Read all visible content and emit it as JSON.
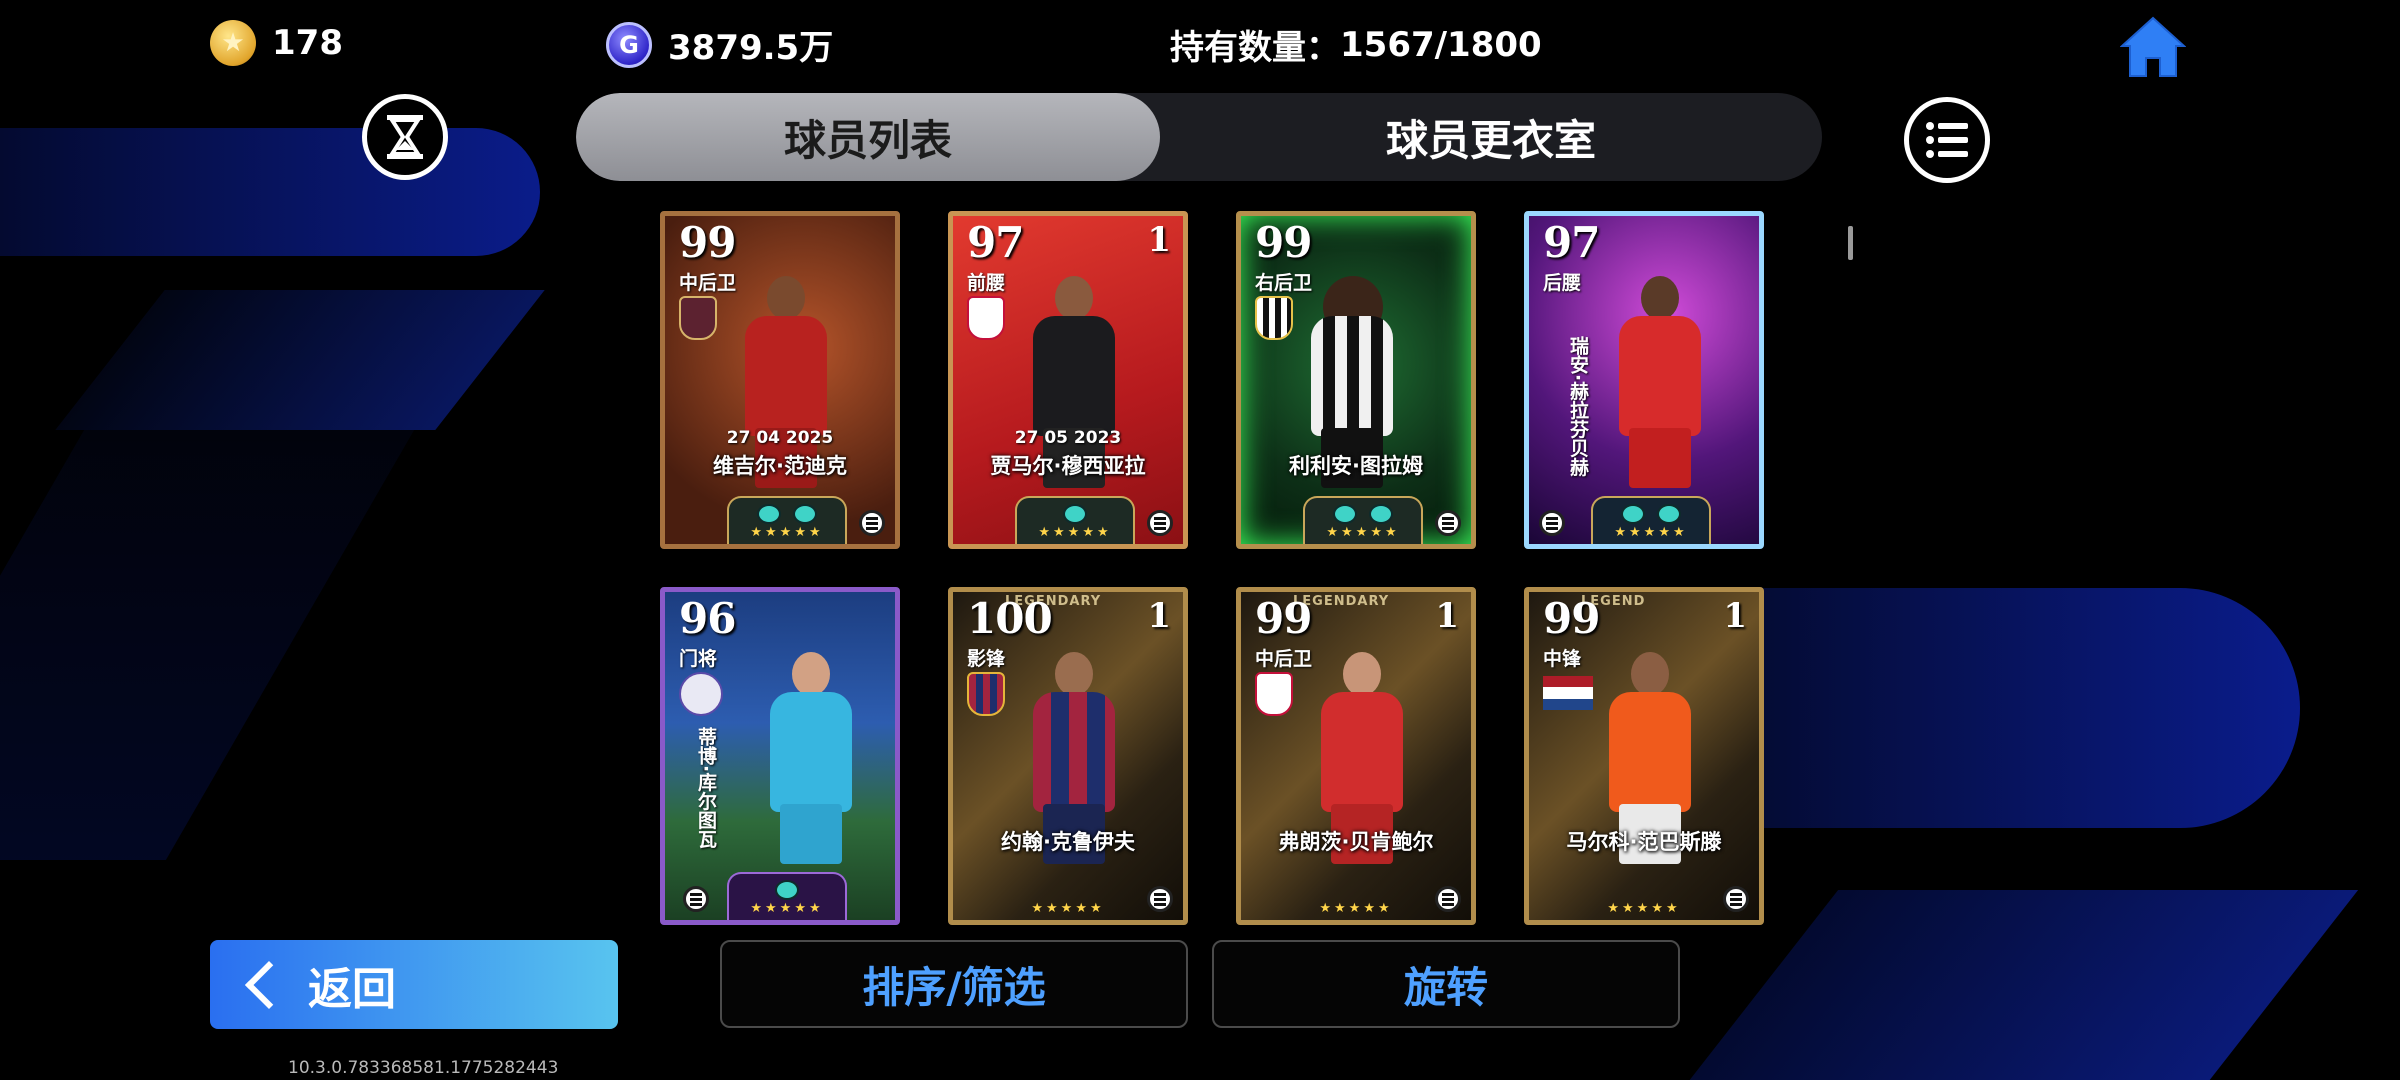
{
  "hud": {
    "coins": "178",
    "gp": "3879.5万",
    "gp_icon_letter": "G",
    "holding_label": "持有数量：",
    "holding_value": "1567/1800"
  },
  "tabs": [
    {
      "label": "球员列表",
      "active": true
    },
    {
      "label": "球员更衣室",
      "active": false
    }
  ],
  "cards": [
    {
      "rating": "99",
      "position": "中后卫",
      "level": "",
      "date": "27 04 2025",
      "name": "维吉尔·范迪克",
      "vertical_name": "",
      "legend": "",
      "theme": "dark-orange"
    },
    {
      "rating": "97",
      "position": "前腰",
      "level": "1",
      "date": "27 05 2023",
      "name": "贾马尔·穆西亚拉",
      "vertical_name": "",
      "legend": "",
      "theme": "red"
    },
    {
      "rating": "99",
      "position": "右后卫",
      "level": "",
      "date": "",
      "name": "利利安·图拉姆",
      "vertical_name": "",
      "legend": "",
      "theme": "green-neon"
    },
    {
      "rating": "97",
      "position": "后腰",
      "level": "",
      "date": "",
      "name": "",
      "vertical_name": "瑞安·赫拉芬贝赫",
      "legend": "",
      "theme": "purple-neon"
    },
    {
      "rating": "96",
      "position": "门将",
      "level": "",
      "date": "",
      "name": "",
      "vertical_name": "蒂博·库尔图瓦",
      "legend": "",
      "theme": "stadium"
    },
    {
      "rating": "100",
      "position": "影锋",
      "level": "1",
      "date": "",
      "name": "约翰·克鲁伊夫",
      "vertical_name": "",
      "legend": "LEGENDARY",
      "theme": "gold"
    },
    {
      "rating": "99",
      "position": "中后卫",
      "level": "1",
      "date": "",
      "name": "弗朗茨·贝肯鲍尔",
      "vertical_name": "",
      "legend": "LEGENDARY",
      "theme": "gold"
    },
    {
      "rating": "99",
      "position": "中锋",
      "level": "1",
      "date": "",
      "name": "马尔科·范巴斯滕",
      "vertical_name": "",
      "legend": "LEGEND",
      "theme": "gold"
    }
  ],
  "buttons": {
    "back": "返回",
    "sort_filter": "排序/筛选",
    "rotate": "旋转"
  },
  "version": "10.3.0.783368581.1775282443",
  "icons": {
    "home": "home-icon",
    "hourglass": "hourglass-icon",
    "menu": "list-menu-icon"
  },
  "colors": {
    "accent_blue": "#4ea0ff",
    "back_gradient_start": "#2a6ff0",
    "back_gradient_end": "#58c4ef",
    "home_icon": "#2f7ff5"
  }
}
